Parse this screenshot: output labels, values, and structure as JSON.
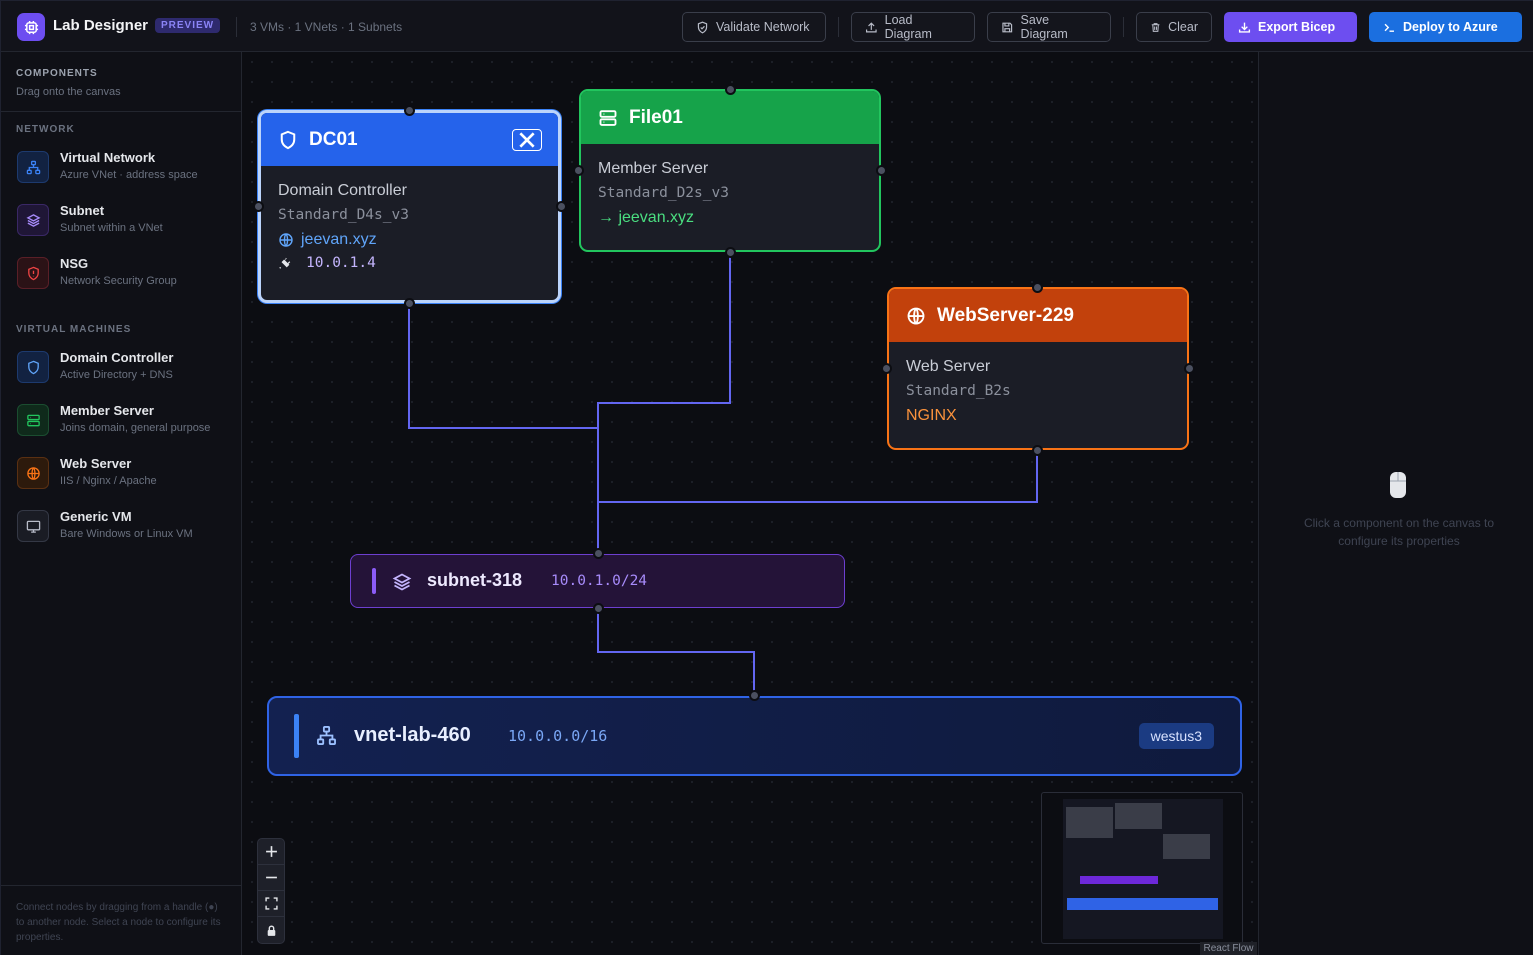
{
  "header": {
    "brand": "Lab Designer",
    "preview_badge": "PREVIEW",
    "counts": "3 VMs · 1 VNets · 1 Subnets",
    "buttons": {
      "validate": "Validate Network",
      "load": "Load Diagram",
      "save": "Save Diagram",
      "clear": "Clear",
      "export": "Export Bicep",
      "deploy": "Deploy to Azure"
    },
    "accent_purple": "#6d4ef0",
    "accent_blue": "#1b6fe0"
  },
  "sidebar": {
    "title": "COMPONENTS",
    "subtitle": "Drag onto the canvas",
    "sections": [
      {
        "label": "NETWORK",
        "items": [
          {
            "name": "Virtual Network",
            "desc": "Azure VNet · address space",
            "icon": "network-icon",
            "color": "#3b82f6"
          },
          {
            "name": "Subnet",
            "desc": "Subnet within a VNet",
            "icon": "layers-icon",
            "color": "#8b5cf6"
          },
          {
            "name": "NSG",
            "desc": "Network Security Group",
            "icon": "shield-alert-icon",
            "color": "#ef4444"
          }
        ]
      },
      {
        "label": "VIRTUAL MACHINES",
        "items": [
          {
            "name": "Domain Controller",
            "desc": "Active Directory + DNS",
            "icon": "shield-icon",
            "color": "#3b82f6"
          },
          {
            "name": "Member Server",
            "desc": "Joins domain, general purpose",
            "icon": "server-icon",
            "color": "#22c55e"
          },
          {
            "name": "Web Server",
            "desc": "IIS / Nginx / Apache",
            "icon": "globe-icon",
            "color": "#f97316"
          },
          {
            "name": "Generic VM",
            "desc": "Bare Windows or Linux VM",
            "icon": "monitor-icon",
            "color": "#9ca3af"
          }
        ]
      }
    ],
    "footer": "Connect nodes by dragging from a handle (●) to another node. Select a node to configure its properties."
  },
  "canvas": {
    "nodes": {
      "dc01": {
        "title": "DC01",
        "role": "Domain Controller",
        "size": "Standard_D4s_v3",
        "domain": "jeevan.xyz",
        "ip": "10.0.1.4",
        "color": "#2563eb"
      },
      "file01": {
        "title": "File01",
        "role": "Member Server",
        "size": "Standard_D2s_v3",
        "domain": "→ jeevan.xyz",
        "color": "#16a34a"
      },
      "web": {
        "title": "WebServer-229",
        "role": "Web Server",
        "size": "Standard_B2s",
        "stack": "NGINX",
        "color": "#ea580c"
      },
      "subnet": {
        "title": "subnet-318",
        "cidr": "10.0.1.0/24",
        "color": "#7c3aed"
      },
      "vnet": {
        "title": "vnet-lab-460",
        "cidr": "10.0.0.0/16",
        "region": "westus3",
        "color": "#2f63e6"
      }
    },
    "attribution": "React Flow"
  },
  "right_panel": {
    "empty_text": "Click a component on the canvas to configure its properties"
  }
}
